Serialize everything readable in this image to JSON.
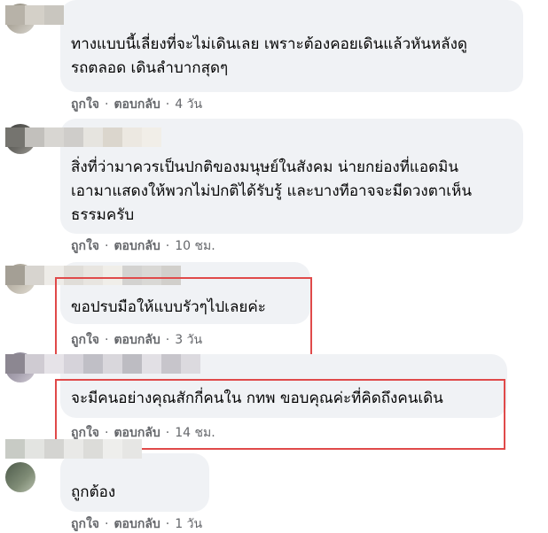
{
  "comments": [
    {
      "text": "ทางแบบนี้เลี่ยงที่จะไม่เดินเลย เพราะต้องคอยเดินแล้วหันหลังดู\nรถตลอด เดินลำบากสุดๆ",
      "like_label": "ถูกใจ",
      "reply_label": "ตอบกลับ",
      "separator": "·",
      "time": "4 วัน"
    },
    {
      "text": "สิ่งที่ว่ามาควรเป็นปกติของมนุษย์ในสังคม น่ายกย่องที่แอดมิน\nเอามาแสดงให้พวกไม่ปกติได้รับรู้ และบางทีอาจจะมีดวงตาเห็น\nธรรมครับ",
      "like_label": "ถูกใจ",
      "reply_label": "ตอบกลับ",
      "separator": "·",
      "time": "10 ชม."
    },
    {
      "text": "ขอปรบมือให้แบบรัวๆไปเลยค่ะ",
      "like_label": "ถูกใจ",
      "reply_label": "ตอบกลับ",
      "separator": "·",
      "time": "3 วัน"
    },
    {
      "text": "จะมีคนอย่างคุณสักกี่คนใน กทพ ขอบคุณค่ะที่คิดถึงคนเดิน",
      "like_label": "ถูกใจ",
      "reply_label": "ตอบกลับ",
      "separator": "·",
      "time": "14 ชม."
    },
    {
      "text": "ถูกต้อง",
      "like_label": "ถูกใจ",
      "reply_label": "ตอบกลับ",
      "separator": "·",
      "time": "1 วัน"
    }
  ],
  "colors": {
    "bubble": "#f0f2f5",
    "text": "#050505",
    "meta": "#65676b",
    "highlight": "#e04a4a"
  }
}
